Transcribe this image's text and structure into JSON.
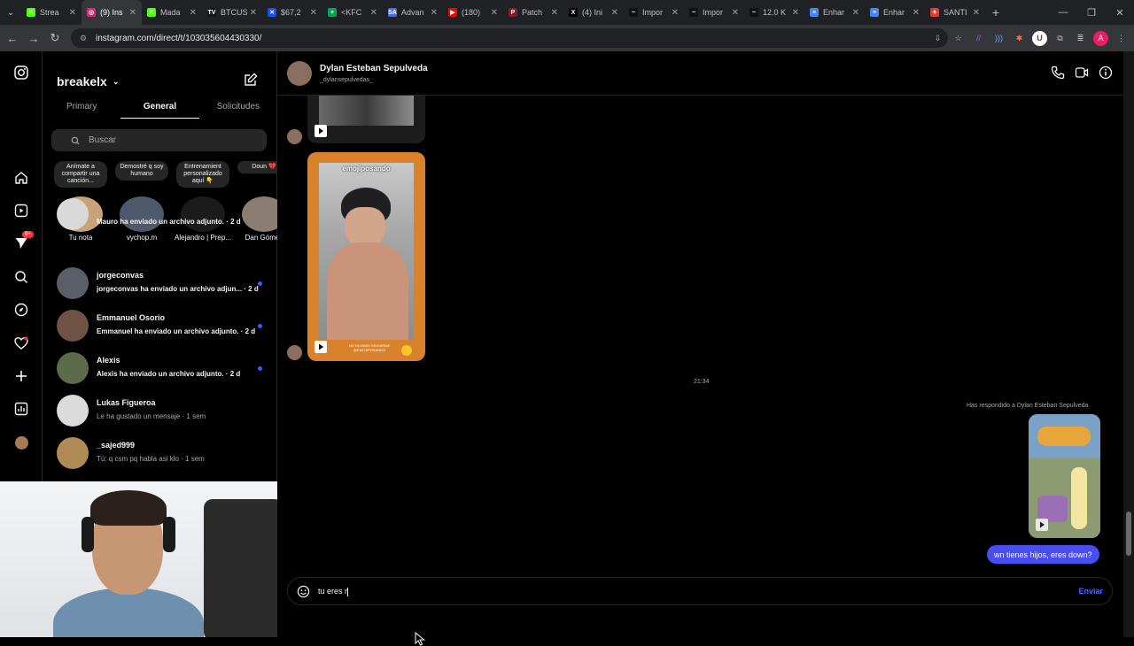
{
  "browser": {
    "tabs": [
      {
        "label": "Strea",
        "color": "#53fc18",
        "glyph": "K"
      },
      {
        "label": "(9) Ins",
        "color": "#d62976",
        "glyph": "◎",
        "active": true
      },
      {
        "label": "Mada",
        "color": "#53fc18",
        "glyph": "K"
      },
      {
        "label": "BTCUS",
        "color": "#131722",
        "glyph": "TV"
      },
      {
        "label": "$67,2",
        "color": "#1652f0",
        "glyph": "✕"
      },
      {
        "label": "<KFC",
        "color": "#0f9d58",
        "glyph": "+"
      },
      {
        "label": "Advan",
        "color": "#4a6ee0",
        "glyph": "SA"
      },
      {
        "label": "(180)",
        "color": "#ff0000",
        "glyph": "▶"
      },
      {
        "label": "Patch",
        "color": "#7a1f2b",
        "glyph": "P"
      },
      {
        "label": "(4) Ini",
        "color": "#000000",
        "glyph": "X"
      },
      {
        "label": "Impor",
        "color": "#111111",
        "glyph": "~"
      },
      {
        "label": "Impor",
        "color": "#111111",
        "glyph": "~"
      },
      {
        "label": "12.0 K",
        "color": "#111111",
        "glyph": "~"
      },
      {
        "label": "Enhar",
        "color": "#4285f4",
        "glyph": "≡"
      },
      {
        "label": "Enhar",
        "color": "#4285f4",
        "glyph": "≡"
      },
      {
        "label": "SANTI",
        "color": "#e53935",
        "glyph": "✦"
      }
    ],
    "url": "instagram.com/direct/t/103035604430330/"
  },
  "inbox": {
    "username": "breakelx",
    "tabs": [
      "Primary",
      "General",
      "Solicitudes"
    ],
    "active_tab": "General",
    "search_placeholder": "Buscar",
    "notes": [
      {
        "bubble": "Anímate a compartir una canción...",
        "name": "Tu nota",
        "color": "#c9a27a"
      },
      {
        "bubble": "Demostré q soy humano",
        "name": "vychop.m",
        "color": "#4e5a6b"
      },
      {
        "bubble": "Entrenamient personalizado aquí 👇",
        "name": "Alejandro | Prep...",
        "color": "#1b1b1b"
      },
      {
        "bubble": "Doun 💔",
        "name": "Dan Gómez",
        "color": "#8a7d74"
      }
    ],
    "conversations": [
      {
        "name": "",
        "message": "Mauro ha enviado un archivo adjunto. · 2 d",
        "unread": true,
        "color": "#d9d9d9"
      },
      {
        "name": "jorgeconvas",
        "message": "jorgeconvas ha enviado un archivo adjun... · 2 d",
        "unread": true,
        "color": "#5a5e66"
      },
      {
        "name": "Emmanuel Osorio",
        "message": "Emmanuel ha enviado un archivo adjunto. · 2 d",
        "unread": true,
        "color": "#6e5344"
      },
      {
        "name": "Alexis",
        "message": "Alexis ha enviado un archivo adjunto. · 2 d",
        "unread": true,
        "color": "#5d6b4a"
      },
      {
        "name": "Lukas Figueroa",
        "message": "Le ha gustado un mensaje · 1 sem",
        "unread": false,
        "color": "#dbdbdb"
      },
      {
        "name": "_sajed999",
        "message": "Tú: q csm pq habla asi klo · 1 sem",
        "unread": false,
        "color": "#b08a55"
      }
    ]
  },
  "leftnav": {
    "notification_badge": "9+"
  },
  "chat": {
    "contact_name": "Dylan Esteban Sepulveda",
    "contact_username": "_dylansepulvedas_",
    "reel_caption_top": "emojiposando",
    "reel_caption_bottom": "NO OLVIDES SEGUIRME @EMOJIPOSANDO",
    "timestamp": "21:34",
    "replied_label": "Has respondido a Dylan Esteban Sepulveda",
    "sent_message": "wn tienes hijos, eres down?",
    "composer_text": "tu eres r",
    "send_label": "Enviar",
    "accent": "#4a4df0"
  }
}
